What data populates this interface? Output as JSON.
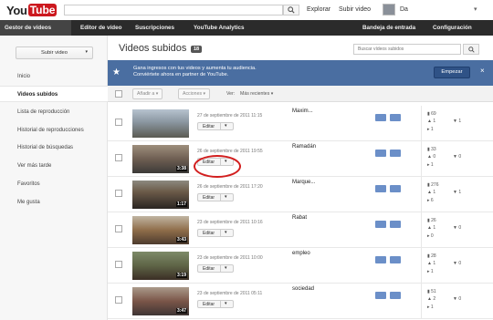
{
  "header": {
    "logo": {
      "you": "You",
      "tube": "Tube"
    },
    "explore": "Explorar",
    "upload": "Subir video",
    "user": "Da"
  },
  "menubar": {
    "items": [
      "Gestor de vídeos",
      "Editor de vídeo",
      "Suscripciones",
      "YouTube Analytics",
      "Bandeja de entrada",
      "Configuración"
    ]
  },
  "sidebar": {
    "upload_button": "Subir video",
    "items": [
      "Inicio",
      "Videos subidos",
      "Lista de reproducción",
      "Historial de reproducciones",
      "Historial de búsquedas",
      "Ver más tarde",
      "Favoritos",
      "Me gusta"
    ]
  },
  "main": {
    "title": "Videos subidos",
    "count": "18",
    "search_placeholder": "Buscar vídeos subidos"
  },
  "promo": {
    "line1": "Gana ingresos con tus videos y aumenta tu audiencia.",
    "line2": "Conviértete ahora en partner de YouTube.",
    "button": "Empezar",
    "close": "×"
  },
  "toolbar": {
    "actions": "Acciones",
    "add_to": "Añadir a",
    "view": "Ver:",
    "recent": "Más recientes"
  },
  "rows": [
    {
      "title": "Maxim...",
      "date": "27 de septiembre de 2011 11:15",
      "duration": "",
      "edit": "Editar",
      "views": "69",
      "likes": "1",
      "comments": "1",
      "dislikes": "1"
    },
    {
      "title": "Ramadán",
      "date": "26 de septiembre de 2011 19:55",
      "duration": "3:38",
      "edit": "Editar",
      "views": "33",
      "likes": "0",
      "comments": "1",
      "dislikes": "0"
    },
    {
      "title": "Marque...",
      "date": "26 de septiembre de 2011 17:20",
      "duration": "1:17",
      "edit": "Editar",
      "views": "276",
      "likes": "1",
      "comments": "6",
      "dislikes": "1"
    },
    {
      "title": "Rabat",
      "date": "23 de septiembre de 2011 10:16",
      "duration": "3:43",
      "edit": "Editar",
      "views": "26",
      "likes": "1",
      "comments": "0",
      "dislikes": "0"
    },
    {
      "title": "empleo",
      "date": "23 de septiembre de 2011 10:00",
      "duration": "3:19",
      "edit": "Editar",
      "views": "28",
      "likes": "1",
      "comments": "1",
      "dislikes": "0"
    },
    {
      "title": "sociedad",
      "date": "23 de septiembre de 2011 05:11",
      "duration": "3:47",
      "edit": "Editar",
      "views": "51",
      "likes": "2",
      "comments": "1",
      "dislikes": "0"
    }
  ],
  "colors": {
    "brand_red": "#cc181e",
    "menubar": "#2b2b2b",
    "promo_blue": "#4a6ea1",
    "highlight_circle": "#d21e1e"
  }
}
